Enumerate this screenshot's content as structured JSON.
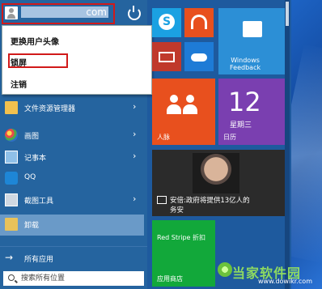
{
  "user": {
    "name": "com",
    "power_icon": "power-icon"
  },
  "dropdown": {
    "change_avatar": "更换用户头像",
    "lock": "锁屏",
    "sign_out": "注销"
  },
  "apps": [
    {
      "label": "文件资源管理器",
      "icon": "folder-icon",
      "has_submenu": true
    },
    {
      "label": "画图",
      "icon": "paint-icon",
      "has_submenu": true
    },
    {
      "label": "记事本",
      "icon": "notepad-icon",
      "has_submenu": true
    },
    {
      "label": "QQ",
      "icon": "qq-icon",
      "has_submenu": false
    },
    {
      "label": "截图工具",
      "icon": "snipping-icon",
      "has_submenu": true
    },
    {
      "label": "卸载",
      "icon": "uninstall-icon",
      "has_submenu": false
    }
  ],
  "all_apps": "所有应用",
  "search": {
    "placeholder": "搜索所有位置"
  },
  "tiles": {
    "windows_feedback": "Windows\nFeedback",
    "people": "人脉",
    "calendar_day": "12",
    "calendar_weekday": "星期三",
    "calendar": "日历",
    "news_headline": "安倍:政府将提供13亿人的",
    "news_headline_2": "务安",
    "store_label": "Red Stripe 折扣",
    "store": "应用商店"
  },
  "watermark": {
    "text": "当家软件园",
    "url": "www.dowikr.com"
  },
  "colors": {
    "start_bg": "#1e5a9e",
    "left_col": "#25649f",
    "highlight_box": "#d11a1a",
    "skype": "#1ba1e2",
    "orange": "#e8501e",
    "green": "#12a83a",
    "blue_tile": "#2c8fd6"
  }
}
